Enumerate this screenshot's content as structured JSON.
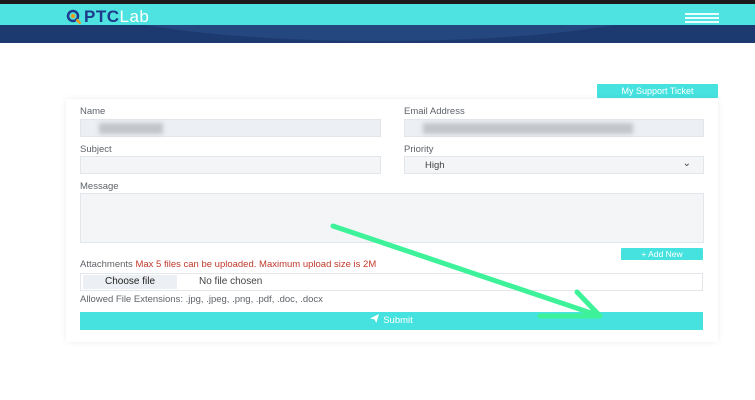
{
  "header": {
    "logo_part1": "PTC",
    "logo_part2": "Lab",
    "menu_icon": "hamburger-menu-icon"
  },
  "card": {
    "ticket_button": "My Support Ticket",
    "name_label": "Name",
    "email_label": "Email Address",
    "subject_label": "Subject",
    "priority_label": "Priority",
    "priority_value": "High",
    "message_label": "Message",
    "add_new_button": "Add New",
    "attachments_label": "Attachments",
    "attachments_note": "Max 5 files can be uploaded. Maximum upload size is 2M",
    "choose_file_button": "Choose file",
    "no_file_text": "No file chosen",
    "allowed_extensions": "Allowed File Extensions: .jpg, .jpeg, .png, .pdf, .doc, .docx",
    "submit_button": "Submit"
  },
  "colors": {
    "accent": "#46e2df",
    "header": "#4ee3e1",
    "banner": "#1d3a70",
    "arrow": "#3ef29a",
    "warning_text": "#c0392b"
  }
}
